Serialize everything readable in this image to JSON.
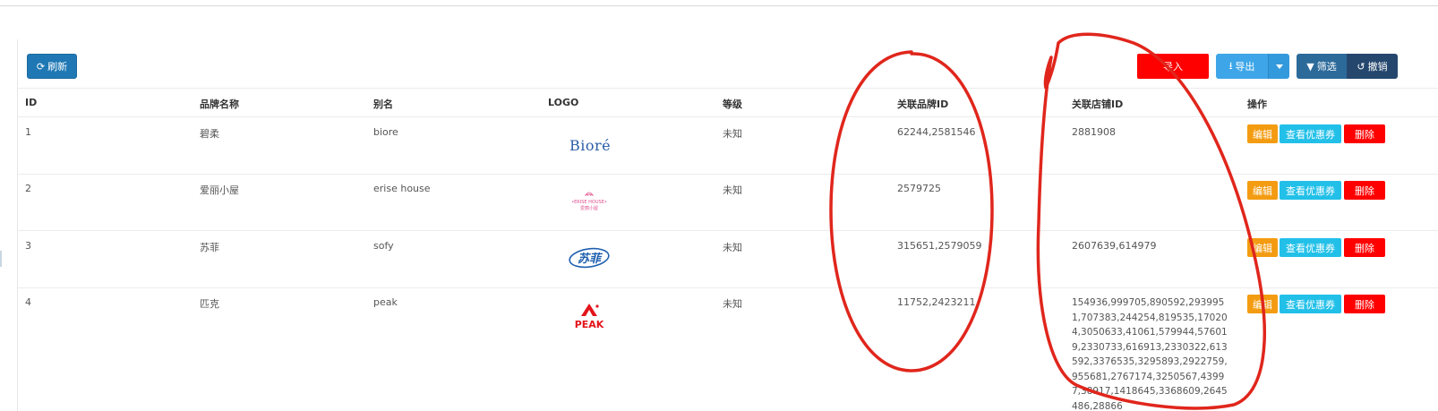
{
  "toolbar": {
    "refresh_label": "刷新",
    "import_label": "导入",
    "export_label": "导出",
    "filter_label": "筛选",
    "undo_label": "撤销"
  },
  "table": {
    "columns": [
      "ID",
      "品牌名称",
      "别名",
      "LOGO",
      "等级",
      "关联品牌ID",
      "关联店铺ID",
      "操作"
    ],
    "rows": [
      {
        "id": "1",
        "name": "碧柔",
        "alias": "biore",
        "logo": "biore-logo",
        "logo_text": "Bioré",
        "level": "未知",
        "brand_ids": "62244,2581546",
        "shop_ids": "2881908"
      },
      {
        "id": "2",
        "name": "爱丽小屋",
        "alias": "erise house",
        "logo": "erise-house-logo",
        "logo_text": "ERISE HOUSE 爱丽小屋",
        "level": "未知",
        "brand_ids": "2579725",
        "shop_ids": ""
      },
      {
        "id": "3",
        "name": "苏菲",
        "alias": "sofy",
        "logo": "sofy-logo",
        "logo_text": "苏菲",
        "level": "未知",
        "brand_ids": "315651,2579059",
        "shop_ids": "2607639,614979"
      },
      {
        "id": "4",
        "name": "匹克",
        "alias": "peak",
        "logo": "peak-logo",
        "logo_text": "PEAK",
        "level": "未知",
        "brand_ids": "11752,2423211",
        "shop_ids": "154936,999705,890592,2939951,707383,244254,819535,170204,3050633,41061,579944,576019,2330733,616913,2330322,613592,3376535,3295893,2922759,955681,2767174,3250567,43997,38917,1418645,3368609,2645486,28866"
      }
    ],
    "actions": {
      "edit": "编辑",
      "coupon": "查看优惠券",
      "delete": "删除"
    }
  },
  "colors": {
    "annotation": "#e0261c",
    "refresh": "#1f78b4",
    "import": "#ff0000",
    "export": "#3ea6e8",
    "filter": "#2c6a9a",
    "undo": "#25476e",
    "edit": "#f39c12",
    "coupon": "#22c0e8",
    "delete": "#ff0000"
  }
}
